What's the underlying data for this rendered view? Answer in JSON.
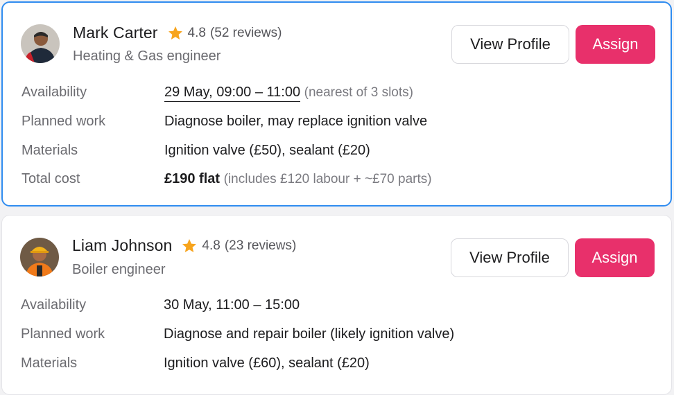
{
  "providers": [
    {
      "name": "Mark Carter",
      "rating": "4.8",
      "reviews": "(52 reviews)",
      "role": "Heating & Gas engineer",
      "view_profile_label": "View Profile",
      "assign_label": "Assign",
      "details": {
        "availability_label": "Availability",
        "availability_value": "29 May, 09:00 – 11:00",
        "availability_note": "(nearest of 3 slots)",
        "work_label": "Planned work",
        "work_value": "Diagnose boiler, may replace ignition valve",
        "materials_label": "Materials",
        "materials_value": "Ignition valve (£50), sealant (£20)",
        "cost_label": "Total cost",
        "cost_value": "£190 flat",
        "cost_note": "(includes £120 labour + ~£70 parts)"
      }
    },
    {
      "name": "Liam Johnson",
      "rating": "4.8",
      "reviews": "(23 reviews)",
      "role": "Boiler engineer",
      "view_profile_label": "View Profile",
      "assign_label": "Assign",
      "details": {
        "availability_label": "Availability",
        "availability_value": "30 May, 11:00 – 15:00",
        "work_label": "Planned work",
        "work_value": "Diagnose and repair boiler (likely ignition valve)",
        "materials_label": "Materials",
        "materials_value": "Ignition valve (£60), sealant (£20)"
      }
    }
  ],
  "colors": {
    "accent": "#e8306b",
    "selected_border": "#2f8cf0",
    "star": "#f7a41d"
  },
  "icons": {
    "rating": "star-icon",
    "avatar": "avatar-photo"
  }
}
